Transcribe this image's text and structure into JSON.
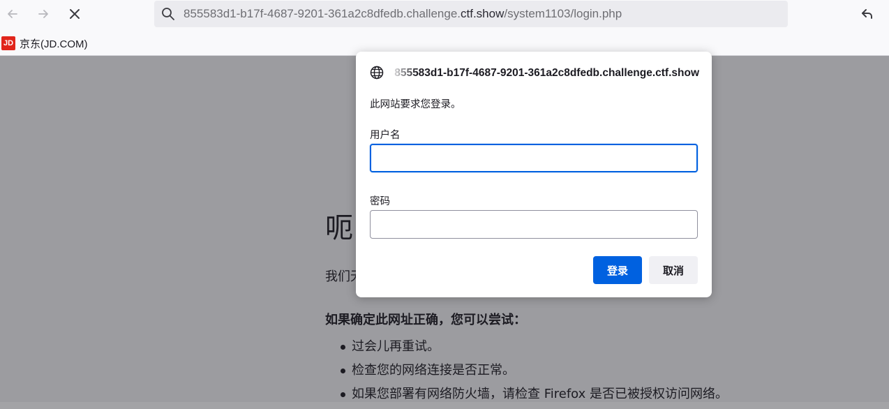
{
  "browser": {
    "url_prefix": "855583d1-b17f-4687-9201-361a2c8dfedb.challenge.",
    "url_domain": "ctf.show",
    "url_path": "/system1103/login.php"
  },
  "bookmarks": [
    {
      "label": "京东(JD.COM)",
      "icon_text": "JD",
      "icon_color": "#e1251b"
    }
  ],
  "error_page": {
    "title": "呃",
    "description": "我们无",
    "try_heading": "如果确定此网址正确，您可以尝试：",
    "suggestions": [
      "过会儿再重试。",
      "检查您的网络连接是否正常。",
      "如果您部署有网络防火墙，请检查 Firefox 是否已被授权访问网络。"
    ]
  },
  "auth_dialog": {
    "host": "855583d1-b17f-4687-9201-361a2c8dfedb.challenge.ctf.show",
    "message": "此网站要求您登录。",
    "username_label": "用户名",
    "username_value": "",
    "password_label": "密码",
    "password_value": "",
    "login_button": "登录",
    "cancel_button": "取消"
  },
  "colors": {
    "accent": "#0061e0",
    "overlay_page": "#9c9ca0"
  }
}
